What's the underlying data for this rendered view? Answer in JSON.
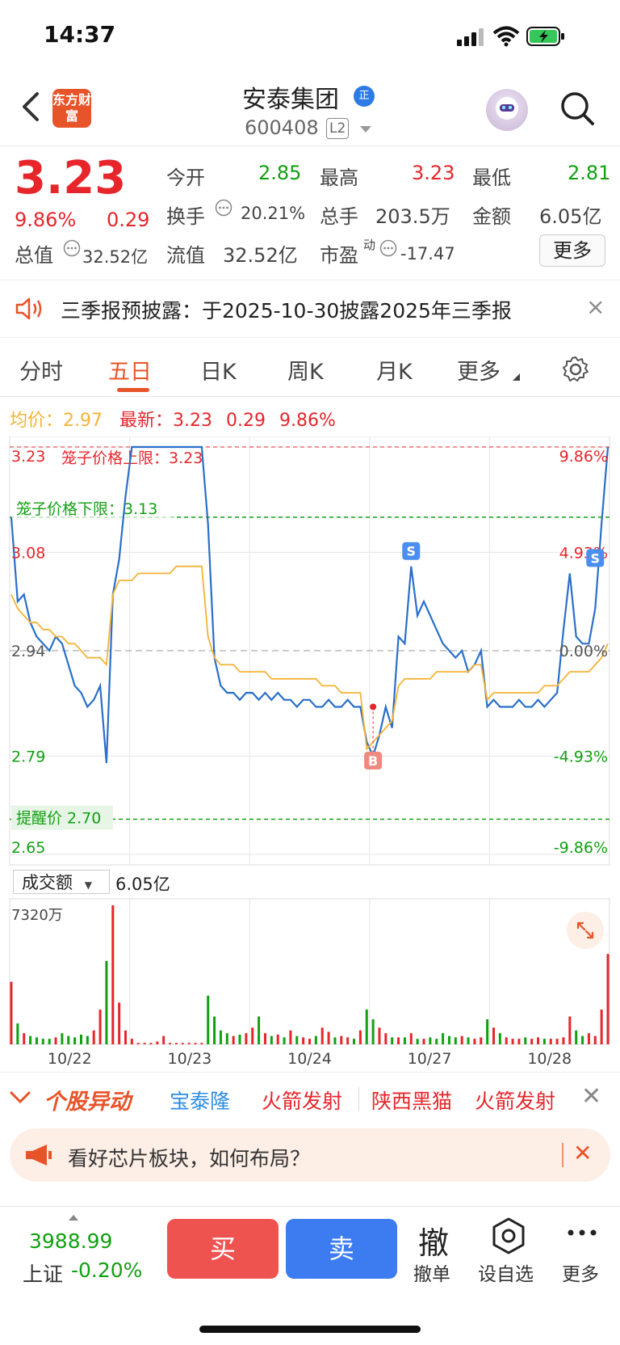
{
  "status_bar": {
    "time": "14:37"
  },
  "header": {
    "app_logo_text": "东方财富",
    "stock_name": "安泰集团",
    "verify_badge": "正",
    "stock_code": "600408",
    "level_badge": "L2"
  },
  "quote": {
    "price": "3.23",
    "change_pct": "9.86%",
    "change": "0.29",
    "open_label": "今开",
    "open": "2.85",
    "high_label": "最高",
    "high": "3.23",
    "low_label": "最低",
    "low": "2.81",
    "turnover_label": "换手",
    "turnover": "20.21%",
    "volume_label": "总手",
    "volume": "203.5万",
    "amount_label": "金额",
    "amount": "6.05亿",
    "mktcap_label": "总值",
    "mktcap": "32.52亿",
    "float_label": "流值",
    "float_cap": "32.52亿",
    "pe_label": "市盈",
    "pe_sup": "动",
    "pe": "-17.47",
    "more_label": "更多"
  },
  "notice": {
    "text": "三季报预披露：于2025-10-30披露2025年三季报",
    "close": "×"
  },
  "tabs": [
    {
      "label": "分时"
    },
    {
      "label": "五日"
    },
    {
      "label": "日K"
    },
    {
      "label": "周K"
    },
    {
      "label": "月K"
    },
    {
      "label": "更多"
    }
  ],
  "legend": {
    "avg_label": "均价：",
    "avg": "2.97",
    "latest_label": "最新：",
    "latest": "3.23",
    "latest_chg": "0.29",
    "latest_pct": "9.86%"
  },
  "chart_data": {
    "type": "line",
    "title": "",
    "y_ticks_left": [
      "3.23",
      "3.08",
      "2.94",
      "2.79",
      "2.65"
    ],
    "y_ticks_right": [
      "9.86%",
      "4.93%",
      "0.00%",
      "-4.93%",
      "-9.86%"
    ],
    "ylim": [
      2.65,
      3.23
    ],
    "prev_close": 2.94,
    "x_labels": [
      "10/22",
      "10/23",
      "10/24",
      "10/27",
      "10/28"
    ],
    "annotations": {
      "upper_limit": "笼子价格上限：3.23",
      "lower_limit": "笼子价格下限：3.13",
      "reminder": "提醒价 2.70",
      "buy_marker": "B",
      "sell_marker": "S"
    },
    "series": [
      {
        "name": "最新",
        "values": [
          3.13,
          3.01,
          3.02,
          2.98,
          2.96,
          2.95,
          2.94,
          2.96,
          2.95,
          2.92,
          2.89,
          2.88,
          2.86,
          2.87,
          2.89,
          2.78,
          3.02,
          3.07,
          3.16,
          3.23,
          3.23,
          3.23,
          3.23,
          3.23,
          3.23,
          3.23,
          3.23,
          3.23,
          3.23,
          3.23,
          3.23,
          3.12,
          2.93,
          2.89,
          2.88,
          2.88,
          2.87,
          2.88,
          2.88,
          2.87,
          2.88,
          2.87,
          2.88,
          2.87,
          2.87,
          2.86,
          2.87,
          2.87,
          2.86,
          2.86,
          2.87,
          2.86,
          2.86,
          2.87,
          2.86,
          2.86,
          2.81,
          2.79,
          2.82,
          2.86,
          2.83,
          2.96,
          2.95,
          3.06,
          2.99,
          3.01,
          2.99,
          2.97,
          2.95,
          2.94,
          2.93,
          2.94,
          2.91,
          2.92,
          2.94,
          2.86,
          2.87,
          2.86,
          2.86,
          2.86,
          2.87,
          2.86,
          2.86,
          2.87,
          2.86,
          2.87,
          2.88,
          2.97,
          3.05,
          2.96,
          2.95,
          2.95,
          3.0,
          3.12,
          3.23
        ]
      },
      {
        "name": "均价",
        "values": [
          3.02,
          3.0,
          2.99,
          2.98,
          2.98,
          2.97,
          2.97,
          2.96,
          2.96,
          2.95,
          2.95,
          2.94,
          2.93,
          2.93,
          2.93,
          2.92,
          3.02,
          3.04,
          3.04,
          3.04,
          3.05,
          3.05,
          3.05,
          3.05,
          3.05,
          3.05,
          3.06,
          3.06,
          3.06,
          3.06,
          3.06,
          2.96,
          2.93,
          2.92,
          2.92,
          2.92,
          2.91,
          2.91,
          2.91,
          2.91,
          2.91,
          2.9,
          2.9,
          2.9,
          2.9,
          2.9,
          2.9,
          2.9,
          2.9,
          2.89,
          2.89,
          2.89,
          2.88,
          2.88,
          2.88,
          2.88,
          2.8,
          2.81,
          2.82,
          2.83,
          2.84,
          2.89,
          2.9,
          2.9,
          2.9,
          2.9,
          2.9,
          2.91,
          2.91,
          2.91,
          2.91,
          2.91,
          2.91,
          2.92,
          2.92,
          2.87,
          2.88,
          2.88,
          2.88,
          2.88,
          2.88,
          2.88,
          2.88,
          2.88,
          2.89,
          2.89,
          2.89,
          2.9,
          2.91,
          2.91,
          2.91,
          2.91,
          2.92,
          2.93,
          2.95
        ]
      }
    ],
    "volume": {
      "label": "成交额",
      "total": "6.05亿",
      "max_label": "7320万",
      "values": [
        0.45,
        0.15,
        0.08,
        0.06,
        0.05,
        0.04,
        0.04,
        0.05,
        0.08,
        0.06,
        0.05,
        0.07,
        0.06,
        0.1,
        0.25,
        0.6,
        1.0,
        0.3,
        0.1,
        0.04,
        0.01,
        0.01,
        0.01,
        0.02,
        0.06,
        0.01,
        0.01,
        0.01,
        0.01,
        0.01,
        0.01,
        0.35,
        0.2,
        0.1,
        0.08,
        0.06,
        0.07,
        0.08,
        0.12,
        0.2,
        0.08,
        0.06,
        0.07,
        0.05,
        0.1,
        0.06,
        0.05,
        0.04,
        0.06,
        0.12,
        0.09,
        0.05,
        0.06,
        0.05,
        0.04,
        0.1,
        0.25,
        0.18,
        0.12,
        0.08,
        0.05,
        0.05,
        0.05,
        0.08,
        0.04,
        0.04,
        0.05,
        0.04,
        0.08,
        0.06,
        0.05,
        0.06,
        0.05,
        0.04,
        0.05,
        0.18,
        0.12,
        0.08,
        0.05,
        0.04,
        0.04,
        0.05,
        0.04,
        0.05,
        0.04,
        0.04,
        0.04,
        0.05,
        0.2,
        0.1,
        0.06,
        0.08,
        0.06,
        0.25,
        0.65
      ]
    }
  },
  "movers": {
    "title": "个股异动",
    "items": [
      "宝泰隆",
      "火箭发射",
      "陕西黑猫",
      "火箭发射"
    ],
    "item_colors": [
      "#2d8ce5",
      "#e6262b",
      "#e6262b",
      "#e6262b"
    ]
  },
  "alert": {
    "text": "看好芯片板块，如何布局？"
  },
  "bottom": {
    "index_value": "3988.99",
    "index_name": "上证",
    "index_change": "-0.20%",
    "buy": "买",
    "sell": "卖",
    "cancel_char": "撤",
    "cancel_label": "撤单",
    "watch_label": "设自选",
    "more_label": "更多"
  },
  "colors": {
    "up": "#e6262b",
    "down": "#12a012",
    "price_line": "#2a6fc9",
    "avg_line": "#f5b335",
    "accent": "#e8542a"
  }
}
